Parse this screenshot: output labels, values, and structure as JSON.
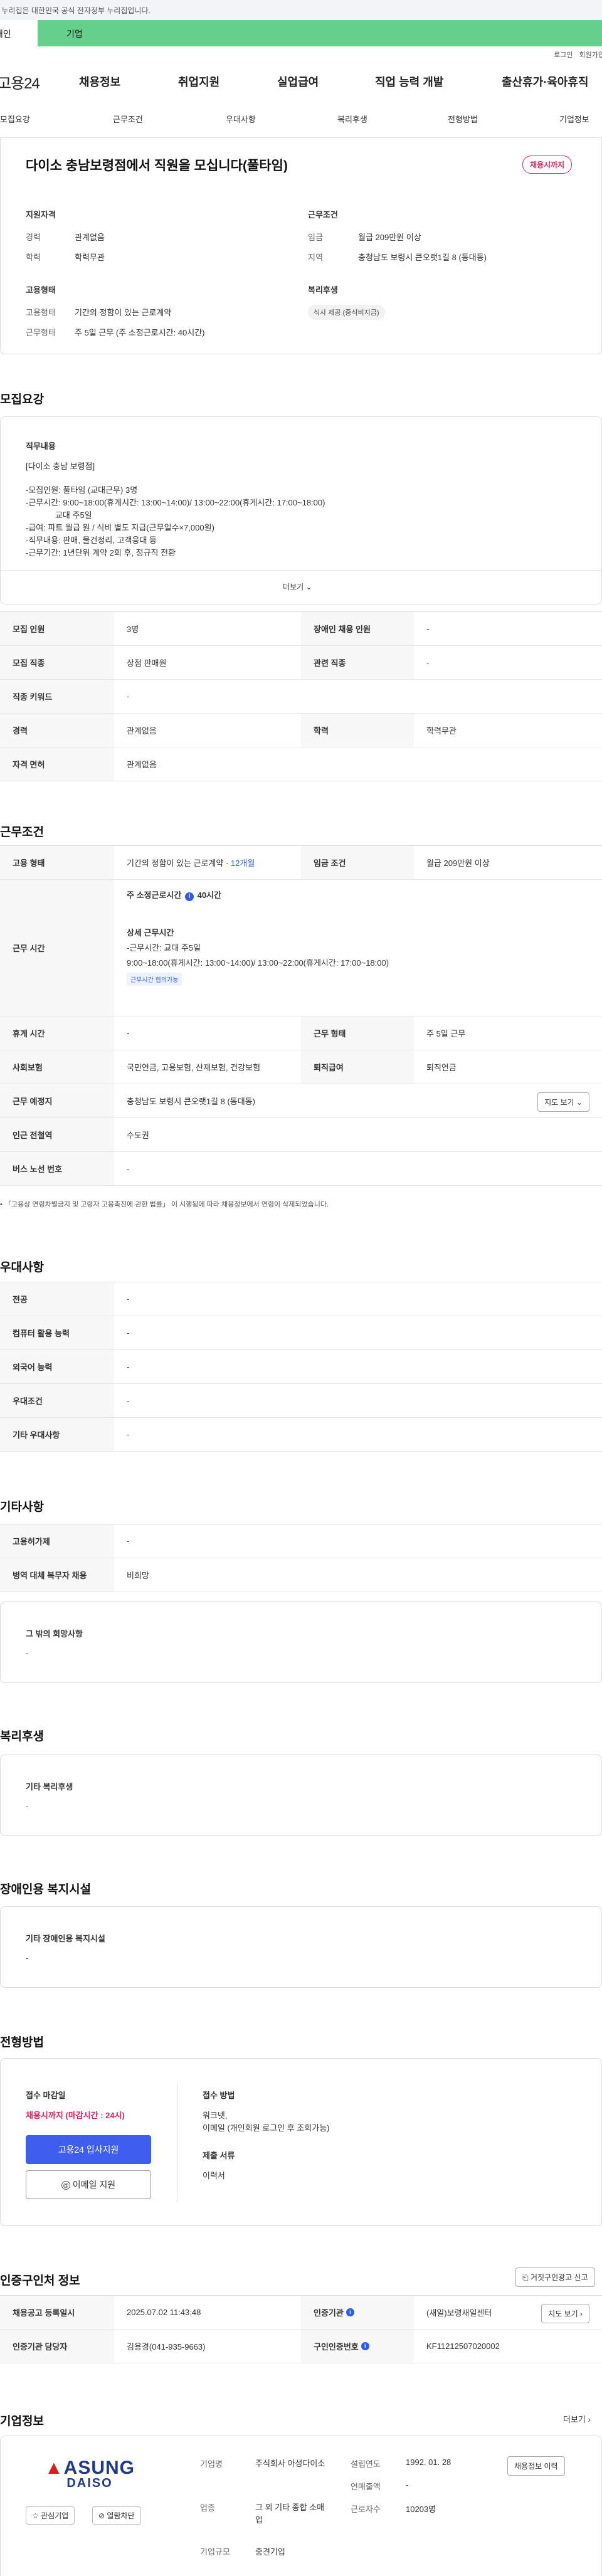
{
  "top_notice": "이 누리집은 대한민국 공식 전자정부 누리집입니다.",
  "tabs": {
    "person": "개인",
    "corporate": "기업"
  },
  "util": {
    "login": "로그인",
    "signup": "회원가입"
  },
  "gnb": {
    "logo": "고용24",
    "items": [
      "채용정보",
      "취업지원",
      "실업급여",
      "직업 능력 개발",
      "출산휴가·육아휴직"
    ]
  },
  "subnav": [
    "모집요강",
    "근무조건",
    "우대사항",
    "복리후생",
    "전형방법",
    "기업정보"
  ],
  "summary": {
    "title": "다이소 충남보령점에서 직원을 모십니다(풀타임)",
    "badge": "채용시까지",
    "qual": {
      "head": "지원자격",
      "k1": "경력",
      "v1": "관계없음",
      "k2": "학력",
      "v2": "학력무관"
    },
    "cond": {
      "head": "근무조건",
      "k1": "임금",
      "v1": "월급 209만원 이상",
      "k2": "지역",
      "v2": "충청남도 보령시 큰오랫1길 8 (동대동)"
    },
    "emp": {
      "head": "고용형태",
      "k1": "고용형태",
      "v1": "기간의 정함이 있는 근로계약",
      "k2": "근무형태",
      "v2": "주 5일 근무 (주 소정근로시간: 40시간)"
    },
    "welfare": {
      "head": "복리후생",
      "tag": "식사 제공 (중식비지급)"
    }
  },
  "recruit": {
    "heading": "모집요강",
    "duty_head": "직무내용",
    "duty_lines": [
      "[다이소 충남 보령점]",
      "-모집인원: 풀타임 (교대근무) 3명",
      "-근무시간: 9:00~18:00(휴게시간: 13:00~14:00)/ 13:00~22:00(휴게시간:  17:00~18:00)",
      "             교대 주5일",
      "-급여: 파트 월급 원  / 식비 별도 지급(근무일수×7,000원)",
      "-직무내용: 판매, 물건정리, 고객응대 등",
      "-근무기간: 1년단위 계약 2회 후, 정규직 전환"
    ],
    "more": "더보기",
    "rows": [
      {
        "th1": "모집 인원",
        "td1": "3명",
        "th2": "장애인 채용 인원",
        "td2": "-"
      },
      {
        "th1": "모집 직종",
        "td1": "상점 판매원",
        "th2": "관련 직종",
        "td2": "-"
      },
      {
        "th1": "직종 키워드",
        "td1": "-"
      },
      {
        "th1": "경력",
        "td1": "관계없음",
        "th2": "학력",
        "td2": "학력무관"
      },
      {
        "th1": "자격 면허",
        "td1": "관계없음"
      }
    ]
  },
  "work": {
    "heading": "근무조건",
    "emp_th": "고용 형태",
    "emp_td": "기간의 정함이 있는 근로계약 · ",
    "emp_period": "12개월",
    "wage_th": "임금 조건",
    "wage_td": "월급 209만원 이상",
    "time_th": "근무 시간",
    "time_week": "주 소정근로시간",
    "time_hours": "40시간",
    "time_detail_head": "상세 근무시간",
    "time_detail": [
      "-근무시간:  교대 주5일",
      "9:00~18:00(휴게시간: 13:00~14:00)/ 13:00~22:00(휴게시간:  17:00~18:00)"
    ],
    "time_tag": "근무시간 협의가능",
    "break_th": "휴게 시간",
    "break_td": "-",
    "form_th": "근무 형태",
    "form_td": "주 5일 근무",
    "ins_th": "사회보험",
    "ins_td": "국민연금, 고용보험, 산재보험, 건강보험",
    "ret_th": "퇴직급여",
    "ret_td": "퇴직연금",
    "place_th": "근무 예정지",
    "place_td": "충청남도 보령시 큰오랫1길 8 (동대동)",
    "map_btn": "지도 보기",
    "subway_th": "인근 전철역",
    "subway_td": "수도권",
    "bus_th": "버스 노선 번호",
    "bus_td": "-",
    "note": "「고용상 연령차별금지 및 고령자 고용촉진에 관한 법률」 이 시행됨에 따라 채용정보에서 연령이 삭제되었습니다."
  },
  "pref": {
    "heading": "우대사항",
    "rows": [
      [
        "전공",
        "-"
      ],
      [
        "컴퓨터 활용 능력",
        "-"
      ],
      [
        "외국어 능력",
        "-"
      ],
      [
        "우대조건",
        "-"
      ],
      [
        "기타 우대사항",
        "-"
      ]
    ]
  },
  "etc": {
    "heading": "기타사항",
    "rows": [
      [
        "고용허가제",
        "-"
      ],
      [
        "병역 대체 복무자 채용",
        "비희망"
      ]
    ],
    "box_head": "그 밖의 희망사항",
    "box_val": "-"
  },
  "welfare": {
    "heading": "복리후생",
    "box_head": "기타 복리후생",
    "box_val": "-"
  },
  "disabled": {
    "heading": "장애인용 복지시설",
    "box_head": "기타 장애인용 복지시설",
    "box_val": "-"
  },
  "process": {
    "heading": "전형방법",
    "deadline_head": "접수 마감일",
    "deadline": "채용시까지 (마감시간 : 24시)",
    "apply_btn": "고용24 입사지원",
    "email_btn": "이메일 지원",
    "method_head": "접수 방법",
    "method_lines": [
      "워크넷,",
      "이메일 (개인회원 로그인 후 조회가능)"
    ],
    "doc_head": "제출 서류",
    "doc_val": "이력서"
  },
  "agency": {
    "heading": "인증구인처 정보",
    "report_btn": "거짓구인광고 신고",
    "r1": {
      "th1": "채용공고 등록일시",
      "td1": "2025.07.02 11:43:48",
      "th2": "인증기관",
      "td2": "(새일)보령새일센터",
      "btn": "지도 보기"
    },
    "r2": {
      "th1": "인증기관 담당자",
      "td1": "김용경(041-935-9663)",
      "th2": "구인인증번호",
      "td2": "KF11212507020002"
    }
  },
  "company": {
    "heading": "기업정보",
    "more": "더보기",
    "logo_top": "ASUNG",
    "logo_bottom": "DAISO",
    "fav_btn": "관심기업",
    "block_btn": "열람차단",
    "name_k": "기업명",
    "name_v": "주식회사 아성다이소",
    "ind_k": "업종",
    "ind_v": "그 외 기타 종합 소매업",
    "size_k": "기업규모",
    "size_v": "중견기업",
    "est_k": "설립연도",
    "est_v": "1992. 01. 28",
    "sales_k": "연매출액",
    "sales_v": "-",
    "emp_k": "근로자수",
    "emp_v": "10203명",
    "welfare_btn": "채용정보 이력"
  }
}
